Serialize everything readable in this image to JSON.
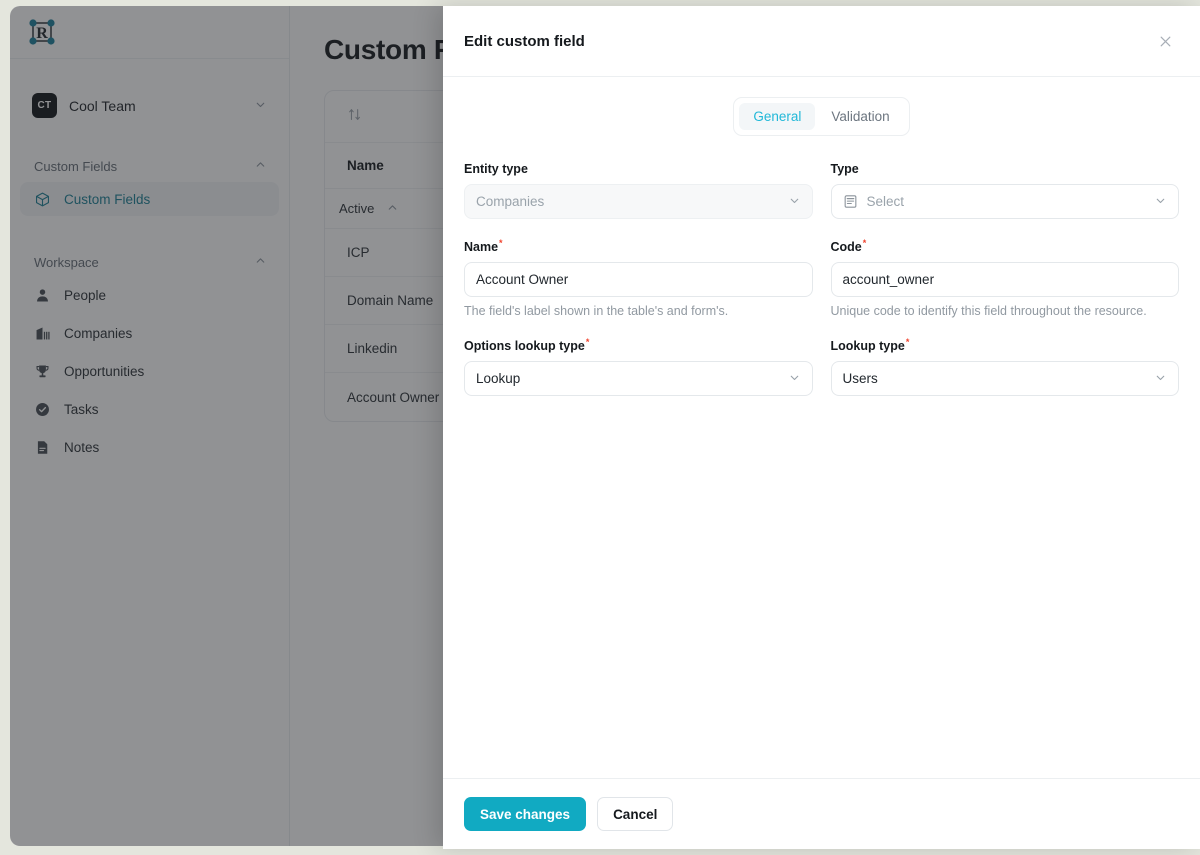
{
  "colors": {
    "accent": "#11aac2",
    "tab_active_text": "#21b8d8",
    "sidebar_active_text": "#1b7f95",
    "required_mark": "#f0432e",
    "overlay": "rgba(35,38,42,0.50)",
    "page_background": "#e4e6dd"
  },
  "sidebar": {
    "logo_letter": "R",
    "team": {
      "initials": "CT",
      "name": "Cool Team",
      "caret": "chevron-down-icon"
    },
    "sections": [
      {
        "title": "Custom Fields",
        "collapse_icon": "chevron-up-icon",
        "items": [
          {
            "label": "Custom Fields",
            "icon": "cube-icon",
            "active": true
          }
        ]
      },
      {
        "title": "Workspace",
        "collapse_icon": "chevron-up-icon",
        "items": [
          {
            "label": "People",
            "icon": "person-icon",
            "active": false
          },
          {
            "label": "Companies",
            "icon": "building-icon",
            "active": false
          },
          {
            "label": "Opportunities",
            "icon": "trophy-icon",
            "active": false
          },
          {
            "label": "Tasks",
            "icon": "check-circle-icon",
            "active": false
          },
          {
            "label": "Notes",
            "icon": "document-icon",
            "active": false
          }
        ]
      }
    ]
  },
  "main": {
    "page_title": "Custom Fields",
    "table": {
      "sort_icon": "sort-arrows-icon",
      "columns": [
        "Name"
      ],
      "group": {
        "label": "Active",
        "collapse_icon": "chevron-up-icon"
      },
      "rows": [
        {
          "name": "ICP"
        },
        {
          "name": "Domain Name"
        },
        {
          "name": "Linkedin"
        },
        {
          "name": "Account Owner"
        }
      ]
    }
  },
  "modal": {
    "title": "Edit custom field",
    "close_icon": "close-icon",
    "tabs": [
      {
        "label": "General",
        "active": true
      },
      {
        "label": "Validation",
        "active": false
      }
    ],
    "fields": {
      "entity_type": {
        "label": "Entity type",
        "value": "Companies",
        "disabled": true,
        "caret": "chevron-down-icon"
      },
      "type": {
        "label": "Type",
        "placeholder": "Select",
        "lead_icon": "form-list-icon",
        "caret": "chevron-down-icon"
      },
      "name": {
        "label": "Name",
        "required": true,
        "required_mark": "*",
        "value": "Account Owner",
        "help": "The field's label shown in the table's and form's."
      },
      "code": {
        "label": "Code",
        "required": true,
        "required_mark": "*",
        "value": "account_owner",
        "help": "Unique code to identify this field throughout the resource."
      },
      "options_lookup_type": {
        "label": "Options lookup type",
        "required": true,
        "required_mark": "*",
        "value": "Lookup",
        "caret": "chevron-down-icon"
      },
      "lookup_type": {
        "label": "Lookup type",
        "required": true,
        "required_mark": "*",
        "value": "Users",
        "caret": "chevron-down-icon"
      }
    },
    "footer": {
      "save_label": "Save changes",
      "cancel_label": "Cancel"
    }
  }
}
